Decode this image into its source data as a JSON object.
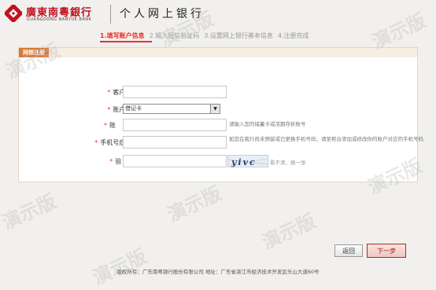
{
  "header": {
    "bank_name_cn": "廣東南粵銀行",
    "bank_name_en": "GUANGDONG NANYUE BANK",
    "app_title": "个人网上银行"
  },
  "steps": [
    {
      "label": "1.填写账户信息",
      "active": true
    },
    {
      "label": "2.输入短信验证码",
      "active": false
    },
    {
      "label": "3.设置网上银行基本信息",
      "active": false
    },
    {
      "label": "4.注册完成",
      "active": false
    }
  ],
  "panel": {
    "tab_label": "网银注册"
  },
  "form": {
    "name": {
      "label": "客户姓名:",
      "value": ""
    },
    "account_type": {
      "label": "账户类型:",
      "selected": "借记卡"
    },
    "account_no": {
      "label": "账        号:",
      "value": "",
      "hint": "请输入您的储蓄卡或活期存折账号"
    },
    "phone_last4": {
      "label": "手机号后四位:",
      "value": "",
      "hint": "如您在我行尚未预留或已更换手机号码，请至柜台添加或修改你的账户对应的手机号码"
    },
    "captcha": {
      "label": "验 证 码:",
      "value": "",
      "image_text": "yivc",
      "refresh_text": "看不清，换一张"
    }
  },
  "watermark": "演示版",
  "buttons": {
    "back": "返回",
    "next": "下一步"
  },
  "footer": "版权所有：广东南粤银行股份有限公司   地址：广东省湛江市经济技术开发区乐山大道60号"
}
